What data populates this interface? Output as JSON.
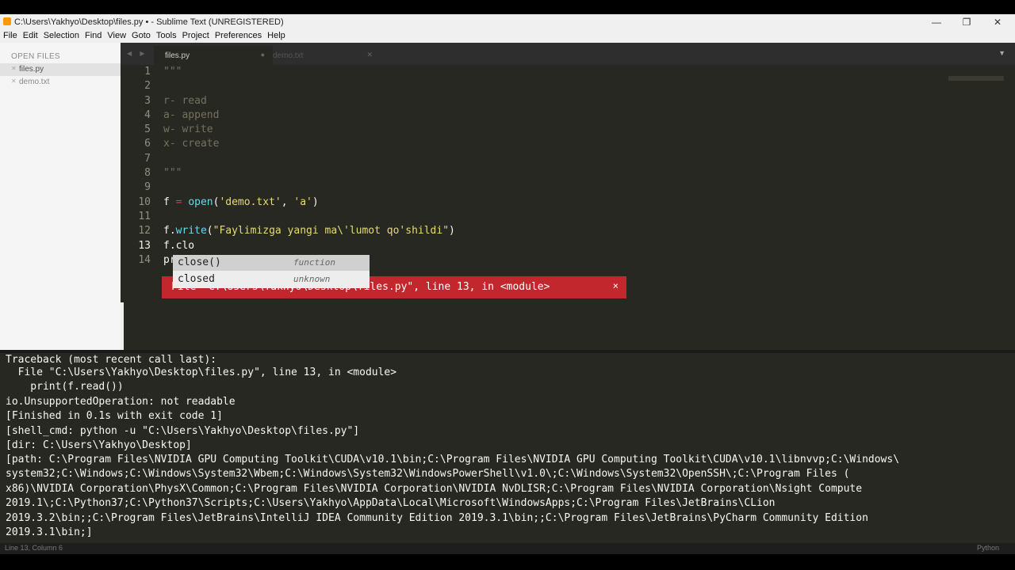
{
  "window": {
    "title": "C:\\Users\\Yakhyo\\Desktop\\files.py • - Sublime Text (UNREGISTERED)",
    "minimize": "—",
    "restore": "❐",
    "close": "✕"
  },
  "menu": [
    "File",
    "Edit",
    "Selection",
    "Find",
    "View",
    "Goto",
    "Tools",
    "Project",
    "Preferences",
    "Help"
  ],
  "sidebar": {
    "header": "OPEN FILES",
    "items": [
      {
        "label": "files.py",
        "close": "✕"
      },
      {
        "label": "demo.txt",
        "close": "✕"
      }
    ]
  },
  "tabs": [
    {
      "label": "files.py",
      "state": "●"
    },
    {
      "label": "demo.txt",
      "state": "✕"
    }
  ],
  "tab_nav": "◀ ▶",
  "tab_overflow": "▼",
  "editor": {
    "line_numbers": [
      "1",
      "2",
      "3",
      "4",
      "5",
      "6",
      "7",
      "8",
      "9",
      "10",
      "11",
      "12",
      "13",
      "14"
    ],
    "lines": {
      "l1": "\"\"\"",
      "l3": "r- read",
      "l4": "a- append",
      "l5": "w- write",
      "l6": "x- create",
      "l8": "\"\"\"",
      "l10_var": "f",
      "l10_eq": " = ",
      "l10_fn": "open",
      "l10_p1": "(",
      "l10_s1": "'demo.txt'",
      "l10_c": ", ",
      "l10_s2": "'a'",
      "l10_p2": ")",
      "l12_obj": "f.",
      "l12_fn": "write",
      "l12_p1": "(",
      "l12_str": "\"Faylimizga yangi ma\\'lumot qo'shildi\"",
      "l12_p2": ")",
      "l13": "f.clo",
      "l14": "pr"
    }
  },
  "autocomplete": [
    {
      "name": "close()",
      "kind": "function"
    },
    {
      "name": "closed",
      "kind": "unknown"
    }
  ],
  "error_popup": {
    "text": "File \"C:\\Users\\Yakhyo\\Desktop\\files.py\", line 13, in <module>",
    "close": "×"
  },
  "console": [
    "Traceback (most recent call last):",
    "  File \"C:\\Users\\Yakhyo\\Desktop\\files.py\", line 13, in <module>",
    "    print(f.read())",
    "io.UnsupportedOperation: not readable",
    "[Finished in 0.1s with exit code 1]",
    "[shell_cmd: python -u \"C:\\Users\\Yakhyo\\Desktop\\files.py\"]",
    "[dir: C:\\Users\\Yakhyo\\Desktop]",
    "[path: C:\\Program Files\\NVIDIA GPU Computing Toolkit\\CUDA\\v10.1\\bin;C:\\Program Files\\NVIDIA GPU Computing Toolkit\\CUDA\\v10.1\\libnvvp;C:\\Windows\\",
    "system32;C:\\Windows;C:\\Windows\\System32\\Wbem;C:\\Windows\\System32\\WindowsPowerShell\\v1.0\\;C:\\Windows\\System32\\OpenSSH\\;C:\\Program Files (",
    "x86)\\NVIDIA Corporation\\PhysX\\Common;C:\\Program Files\\NVIDIA Corporation\\NVIDIA NvDLISR;C:\\Program Files\\NVIDIA Corporation\\Nsight Compute",
    "2019.1\\;C:\\Python37;C:\\Python37\\Scripts;C:\\Users\\Yakhyo\\AppData\\Local\\Microsoft\\WindowsApps;C:\\Program Files\\JetBrains\\CLion",
    "2019.3.2\\bin;;C:\\Program Files\\JetBrains\\IntelliJ IDEA Community Edition 2019.3.1\\bin;;C:\\Program Files\\JetBrains\\PyCharm Community Edition",
    "2019.3.1\\bin;]"
  ],
  "status": {
    "left": "Line 13, Column 6",
    "right": "Python"
  }
}
